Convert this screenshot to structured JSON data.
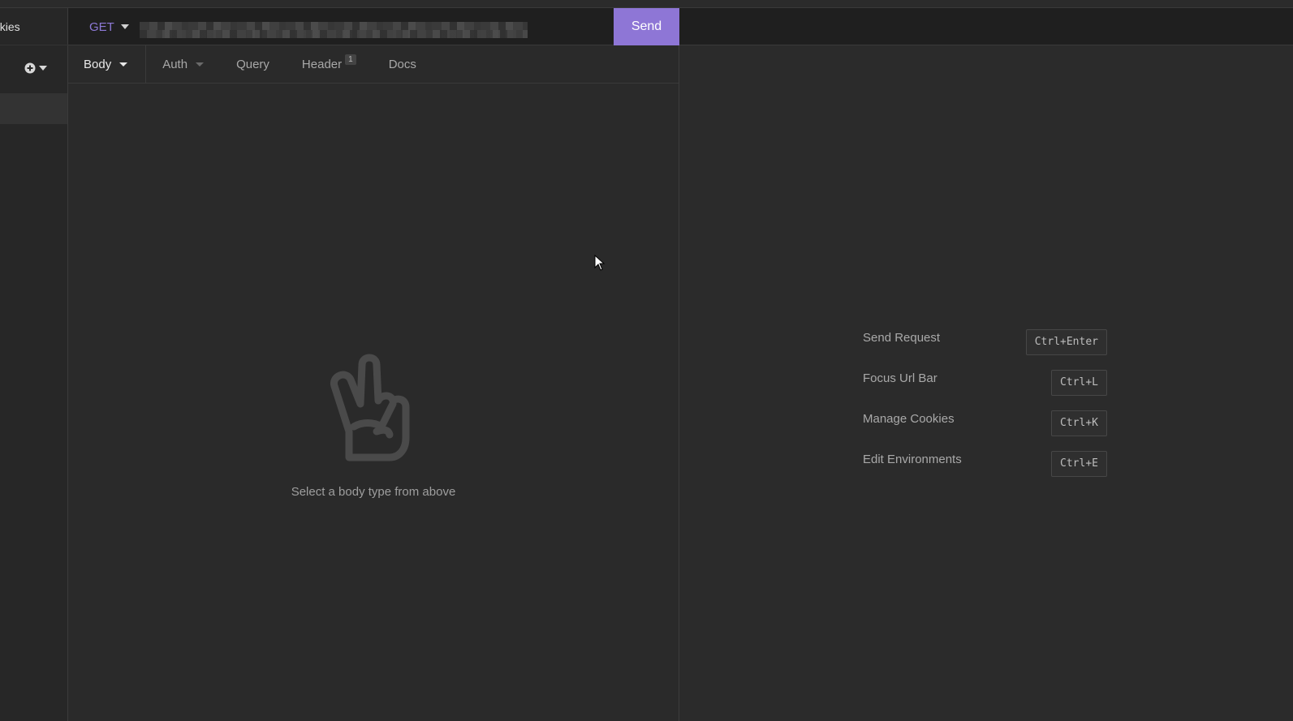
{
  "sidebar": {
    "cookies_partial_label": "okies",
    "add_button_icon": "plus-circle-icon",
    "add_dropdown_icon": "caret-down-icon"
  },
  "request": {
    "method": "GET",
    "url_redacted": true,
    "send_label": "Send",
    "tabs": [
      {
        "label": "Body",
        "active": true,
        "has_caret": true
      },
      {
        "label": "Auth",
        "active": false,
        "has_caret": true
      },
      {
        "label": "Query",
        "active": false,
        "has_caret": false
      },
      {
        "label": "Header",
        "active": false,
        "has_caret": false,
        "badge": "1"
      },
      {
        "label": "Docs",
        "active": false,
        "has_caret": false
      }
    ],
    "empty_state_icon": "peace-hand-icon",
    "empty_state_text": "Select a body type from above"
  },
  "response": {
    "shortcuts": [
      {
        "label": "Send Request",
        "key": "Ctrl+Enter"
      },
      {
        "label": "Focus Url Bar",
        "key": "Ctrl+L"
      },
      {
        "label": "Manage Cookies",
        "key": "Ctrl+K"
      },
      {
        "label": "Edit Environments",
        "key": "Ctrl+E"
      }
    ]
  },
  "colors": {
    "accent": "#8e76d6",
    "method_text": "#8e7ad8",
    "background": "#2b2b2b",
    "topbar": "#1f1f1f"
  }
}
